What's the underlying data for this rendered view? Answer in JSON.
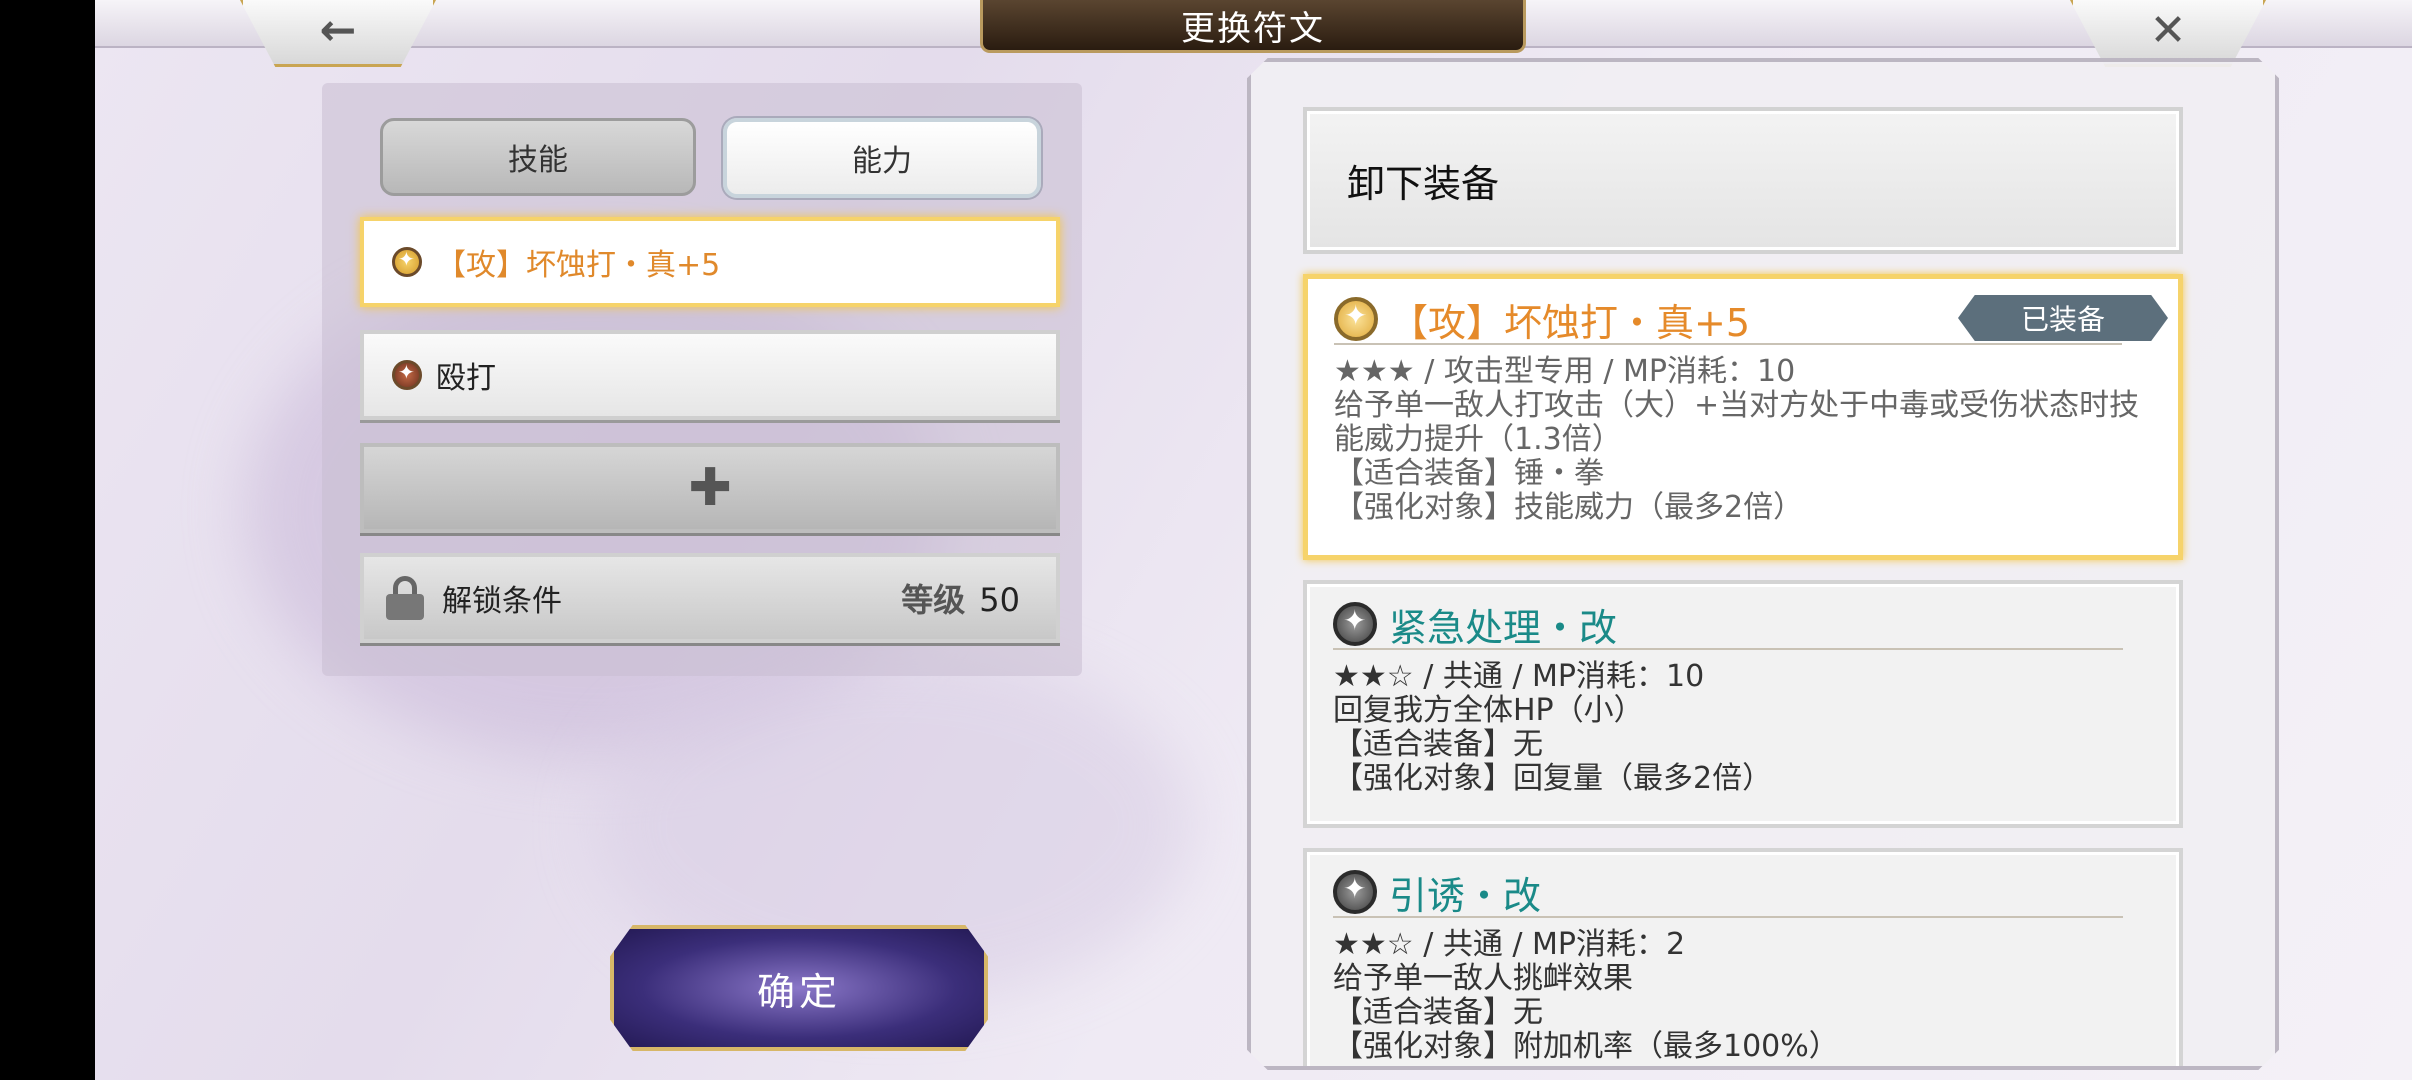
{
  "window": {
    "title": "更换符文"
  },
  "nav": {
    "back_glyph": "←",
    "close_glyph": "✕"
  },
  "tabs": [
    {
      "label": "技能",
      "state": "inactive"
    },
    {
      "label": "能力",
      "state": "active"
    }
  ],
  "slots": {
    "selected": {
      "label": "【攻】坏蚀打・真+5",
      "icon": "gold-rune-icon"
    },
    "normal": {
      "label": "殴打",
      "icon": "brown-rune-icon"
    },
    "add_glyph": "✚",
    "locked": {
      "label": "解锁条件",
      "level_label": "等级",
      "level_value": "50"
    }
  },
  "confirm_label": "确定",
  "list": {
    "unequip_label": "卸下装备",
    "cards": [
      {
        "name": "【攻】坏蚀打・真+5",
        "badge": "已装备",
        "meta": "★★★ / 攻击型专用 / MP消耗：10",
        "desc": "给予单一敌人打攻击（大）+当对方处于中毒或受伤状态时技能威力提升（1.3倍）",
        "equip": "【适合装备】锤・拳",
        "enhance": "【强化对象】技能威力（最多2倍）"
      },
      {
        "name": "紧急处理・改",
        "meta": "★★☆ / 共通 / MP消耗：10",
        "desc": "回复我方全体HP（小）",
        "equip": "【适合装备】无",
        "enhance": "【强化对象】回复量（最多2倍）"
      },
      {
        "name": "引诱・改",
        "meta": "★★☆ / 共通 / MP消耗：2",
        "desc": "给予单一敌人挑衅效果",
        "equip": "【适合装备】无",
        "enhance": "【强化对象】附加机率（最多100%）"
      }
    ]
  },
  "colors": {
    "accent_gold": "#f6d36a",
    "rune_name_orange": "#e58a2a",
    "skill_name_teal": "#1a8a88",
    "confirm_purple": "#3b2e7a"
  }
}
